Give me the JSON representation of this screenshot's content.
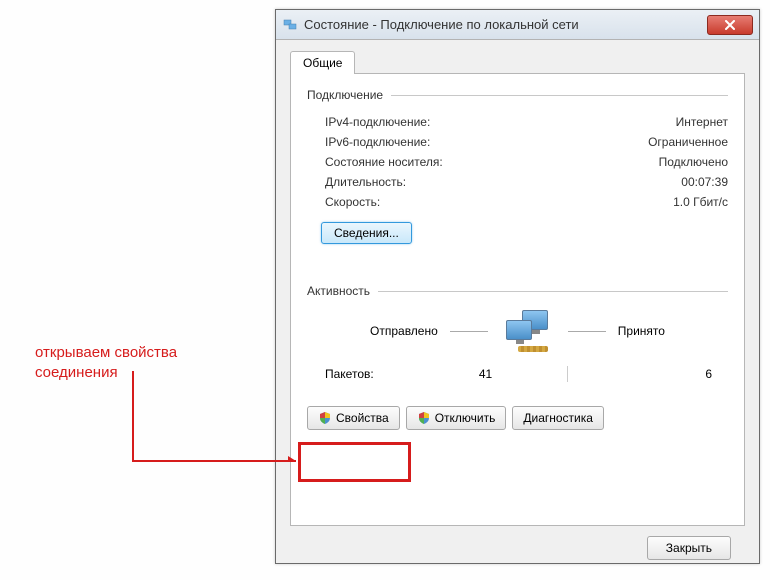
{
  "window": {
    "title": "Состояние - Подключение по локальной сети"
  },
  "tabs": {
    "general": "Общие"
  },
  "connection_group": {
    "title": "Подключение",
    "rows": [
      {
        "label": "IPv4-подключение:",
        "value": "Интернет"
      },
      {
        "label": "IPv6-подключение:",
        "value": "Ограниченное"
      },
      {
        "label": "Состояние носителя:",
        "value": "Подключено"
      },
      {
        "label": "Длительность:",
        "value": "00:07:39"
      },
      {
        "label": "Скорость:",
        "value": "1.0 Гбит/с"
      }
    ],
    "details_btn": "Сведения..."
  },
  "activity_group": {
    "title": "Активность",
    "sent_label": "Отправлено",
    "received_label": "Принято",
    "packets_label": "Пакетов:",
    "packets_sent": "41",
    "packets_received": "6"
  },
  "buttons": {
    "properties": "Свойства",
    "disable": "Отключить",
    "diagnose": "Диагностика",
    "close": "Закрыть"
  },
  "annotation": {
    "line1": "открываем свойства",
    "line2": "соединения"
  }
}
